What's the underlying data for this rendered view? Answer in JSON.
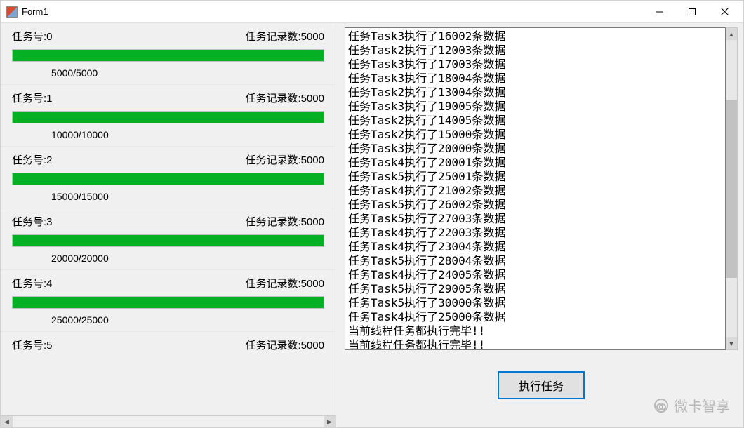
{
  "window": {
    "title": "Form1"
  },
  "labels": {
    "task_id_prefix": "任务号:",
    "record_count_prefix": "任务记录数:"
  },
  "tasks": [
    {
      "id": 0,
      "records": 5000,
      "progress": "5000/5000"
    },
    {
      "id": 1,
      "records": 5000,
      "progress": "10000/10000"
    },
    {
      "id": 2,
      "records": 5000,
      "progress": "15000/15000"
    },
    {
      "id": 3,
      "records": 5000,
      "progress": "20000/20000"
    },
    {
      "id": 4,
      "records": 5000,
      "progress": "25000/25000"
    },
    {
      "id": 5,
      "records": 5000,
      "progress": ""
    }
  ],
  "log_lines": [
    "任务Task3执行了16002条数据",
    "任务Task2执行了12003条数据",
    "任务Task3执行了17003条数据",
    "任务Task3执行了18004条数据",
    "任务Task2执行了13004条数据",
    "任务Task3执行了19005条数据",
    "任务Task2执行了14005条数据",
    "任务Task2执行了15000条数据",
    "任务Task3执行了20000条数据",
    "任务Task4执行了20001条数据",
    "任务Task5执行了25001条数据",
    "任务Task4执行了21002条数据",
    "任务Task5执行了26002条数据",
    "任务Task5执行了27003条数据",
    "任务Task4执行了22003条数据",
    "任务Task4执行了23004条数据",
    "任务Task5执行了28004条数据",
    "任务Task4执行了24005条数据",
    "任务Task5执行了29005条数据",
    "任务Task5执行了30000条数据",
    "任务Task4执行了25000条数据",
    "当前线程任务都执行完毕!!",
    "当前线程任务都执行完毕!!"
  ],
  "button": {
    "execute_label": "执行任务"
  },
  "watermark": {
    "text": "微卡智享"
  }
}
